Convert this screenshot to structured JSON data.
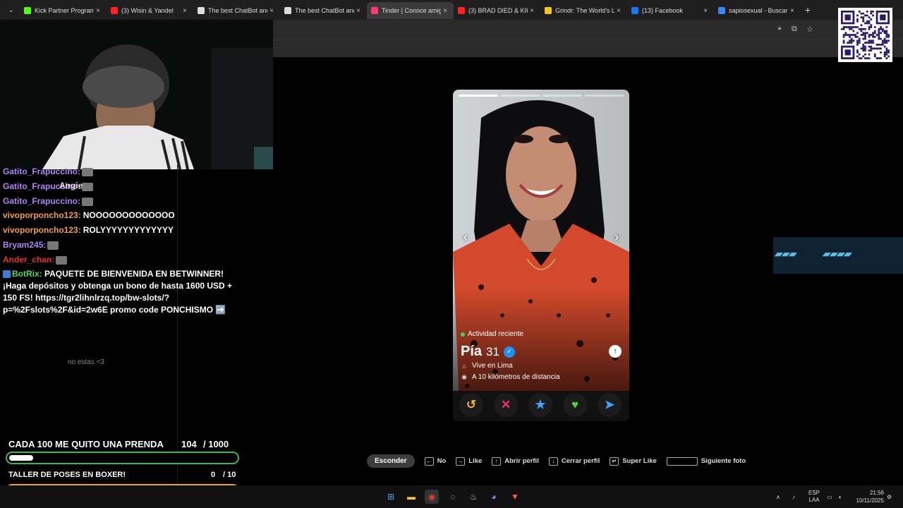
{
  "browser": {
    "tabs": [
      {
        "title": "Kick Partner Program",
        "favicon_color": "#53fc18",
        "active": false
      },
      {
        "title": "(3) Wisin & Yandel",
        "favicon_color": "#ff2020",
        "active": false,
        "audio": true
      },
      {
        "title": "The best ChatBot and",
        "favicon_color": "#dddddd",
        "active": false
      },
      {
        "title": "The best ChatBot and",
        "favicon_color": "#dddddd",
        "active": false
      },
      {
        "title": "Tinder | Conoce amig",
        "favicon_color": "#fe3c72",
        "active": true
      },
      {
        "title": "(3) BRAD DIED & KIK",
        "favicon_color": "#ff2020",
        "active": false
      },
      {
        "title": "Grindr: The World's L",
        "favicon_color": "#f8c51c",
        "active": false
      },
      {
        "title": "(13) Facebook",
        "favicon_color": "#1877f2",
        "active": false
      },
      {
        "title": "sapiosexual - Buscar",
        "favicon_color": "#4285f4",
        "active": false
      }
    ],
    "close_glyph": "×",
    "new_tab_glyph": "+",
    "menu_glyph": "⌄"
  },
  "chat": {
    "messages": [
      {
        "user": "Gatito_Frapuccino:",
        "color": "#b084f5",
        "emote": true
      },
      {
        "user": "Gatito_Frapuccino:",
        "color": "#b084f5",
        "emote": true
      },
      {
        "user": "Gatito_Frapuccino:",
        "color": "#b084f5",
        "emote": true
      },
      {
        "user": "vivoporponcho123:",
        "color": "#f0a036",
        "text": "NOOOOOOOOOOOOO"
      },
      {
        "user": "vivoporponcho123:",
        "color": "#f0a036",
        "text": "ROLYYYYYYYYYYYYY"
      },
      {
        "user": "Bryam245:",
        "color": "#b084f5",
        "emote": true
      },
      {
        "user": "Ander_chan:",
        "color": "#e63434",
        "emote": true
      }
    ],
    "overlay_name": "Angie",
    "ghost_text": "no estas <3",
    "bot": {
      "user": "BotRix:",
      "user_color": "#5bd65b",
      "text": "PAQUETE DE BIENVENIDA EN BETWINNER! ¡Haga depósitos y obtenga un bono de hasta 1600 USD + 150 FS! https://tgr2lihnlrzq.top/bw-slots/?p=%2Fslots%2F&id=2w6E promo code PONCHISMO ➡️"
    }
  },
  "goals": [
    {
      "title": "CADA 100 ME QUITO UNA PRENDA",
      "current": "104",
      "target": "/ 1000",
      "progress": 0.104
    },
    {
      "title": "TALLER DE POSES EN BOXER!",
      "current": "0",
      "target": "/ 10",
      "progress": 0.0
    }
  ],
  "profile": {
    "photo_count": 4,
    "photo_index": 0,
    "activity": "Actividad reciente",
    "name": "Pía",
    "age": "31",
    "verified": true,
    "lives_in": "Vive en Lima",
    "distance": "A 10 kilómetros de distancia",
    "prev_glyph": "‹",
    "next_glyph": "›",
    "info_glyph": "↑"
  },
  "actions": [
    {
      "name": "rewind",
      "glyph": "↺",
      "color": "#f5b03a"
    },
    {
      "name": "nope",
      "glyph": "✕",
      "color": "#fd2b6b"
    },
    {
      "name": "super-like",
      "glyph": "★",
      "color": "#3ca4ff"
    },
    {
      "name": "like",
      "glyph": "♥",
      "color": "#52d04a"
    },
    {
      "name": "boost",
      "glyph": "➤",
      "color": "#3ca4ff"
    }
  ],
  "shortcuts": {
    "hide_label": "Esconder",
    "items": [
      {
        "key": "←",
        "label": "No"
      },
      {
        "key": "→",
        "label": "Like"
      },
      {
        "key": "↑",
        "label": "Abrir perfil"
      },
      {
        "key": "↓",
        "label": "Cerrar perfil"
      },
      {
        "key": "↵",
        "label": "Super Like"
      },
      {
        "key": "",
        "label": "Siguiente foto",
        "wide": true
      }
    ]
  },
  "taskbar": {
    "lang": "ESP",
    "lang_sub": "LAA",
    "time": "21:56",
    "date": "10/11/2025"
  }
}
